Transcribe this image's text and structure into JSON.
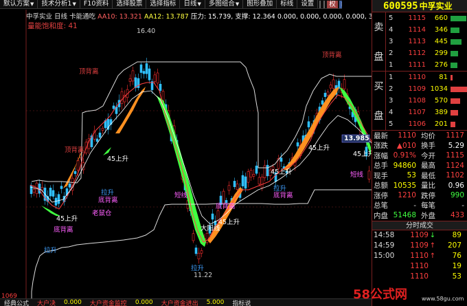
{
  "toolbar": {
    "buttons": [
      "默认方案",
      "技术分析1",
      "F10资料",
      "选择股票",
      "选择指标",
      "日线",
      "多图组合",
      "图形叠加",
      "标线",
      "设置"
    ],
    "tags": [
      "权",
      "线",
      "和"
    ]
  },
  "chart": {
    "info_line": {
      "stock": "中孚实业",
      "period": "日线",
      "extra": "卡能通吃",
      "aa10": "AA10: 13.321",
      "aa12": "AA12: 13.787",
      "pressure": "压力: 15.739,",
      "support": "支撑: 12.364",
      "zeros": "0.000, 0.000, 0.000, 0.000, 30.0"
    },
    "volume_degree": "量能饱和度: 41",
    "axis_left": [
      "1069"
    ],
    "annotations": [
      {
        "text": "16.40",
        "color": "#cccccc"
      },
      {
        "text": "顶背离",
        "color": "#e04040"
      },
      {
        "text": "顶背离",
        "color": "#e04040"
      },
      {
        "text": "顶背离",
        "color": "#e04040"
      },
      {
        "text": "45上升",
        "color": "#ffffff"
      },
      {
        "text": "45上升",
        "color": "#ffffff"
      },
      {
        "text": "45上升",
        "color": "#ffffff"
      },
      {
        "text": "45上升",
        "color": "#ffffff"
      },
      {
        "text": "45上升",
        "color": "#ffffff"
      },
      {
        "text": "45上升",
        "color": "#ffffff"
      },
      {
        "text": "拉升",
        "color": "#40a0ff"
      },
      {
        "text": "拉升",
        "color": "#40a0ff"
      },
      {
        "text": "拉升",
        "color": "#40a0ff"
      },
      {
        "text": "拉升",
        "color": "#40a0ff"
      },
      {
        "text": "底背离",
        "color": "#ff60ff"
      },
      {
        "text": "底背离",
        "color": "#ff60ff"
      },
      {
        "text": "底背离",
        "color": "#ff60ff"
      },
      {
        "text": "底背离",
        "color": "#ff60ff"
      },
      {
        "text": "老鼠仓",
        "color": "#ff60ff"
      },
      {
        "text": "大阳线",
        "color": "#ffffff"
      },
      {
        "text": "短线",
        "color": "#ff60ff"
      },
      {
        "text": "短线",
        "color": "#ff60ff"
      },
      {
        "text": "11.22",
        "color": "#cccccc"
      }
    ],
    "price_tag": "13.985"
  },
  "bottom_bar": [
    "经典公式",
    "大户决",
    "0.000",
    "大户资金监控",
    "0.000",
    "大户资金进出",
    "5.000",
    "指标说"
  ],
  "stock": {
    "code": "600595",
    "name": "中孚实业"
  },
  "sell_book": {
    "label": "卖盘",
    "rows": [
      {
        "idx": "5",
        "price": "1115",
        "vol": "660",
        "bar": 0.95
      },
      {
        "idx": "4",
        "price": "1114",
        "vol": "346",
        "bar": 0.55
      },
      {
        "idx": "3",
        "price": "1113",
        "vol": "445",
        "bar": 0.65
      },
      {
        "idx": "2",
        "price": "1112",
        "vol": "299",
        "bar": 0.45
      },
      {
        "idx": "1",
        "price": "1111",
        "vol": "276",
        "bar": 0.42
      }
    ]
  },
  "buy_book": {
    "label": "买盘",
    "rows": [
      {
        "idx": "1",
        "price": "1110",
        "vol": "81",
        "bar": 0.12
      },
      {
        "idx": "2",
        "price": "1109",
        "vol": "1034",
        "bar": 1.0
      },
      {
        "idx": "3",
        "price": "1108",
        "vol": "570",
        "bar": 0.6
      },
      {
        "idx": "4",
        "price": "1107",
        "vol": "389",
        "bar": 0.45
      },
      {
        "idx": "5",
        "price": "1106",
        "vol": "201",
        "bar": 0.28
      }
    ]
  },
  "quote": [
    {
      "l1": "最新",
      "v1": "1110",
      "c1": "#ff4040",
      "l2": "均价",
      "v2": "1117",
      "c2": "#ff4040"
    },
    {
      "l1": "涨跌",
      "v1": "▲010",
      "c1": "#ff4040",
      "l2": "换手",
      "v2": "5.29",
      "c2": "#ffffff"
    },
    {
      "l1": "涨幅",
      "v1": "0.91%",
      "c1": "#ff4040",
      "l2": "今开",
      "v2": "1115",
      "c2": "#ff4040"
    },
    {
      "l1": "总手",
      "v1": "94860",
      "c1": "#ffff00",
      "l2": "最高",
      "v2": "1124",
      "c2": "#ff4040"
    },
    {
      "l1": "现手",
      "v1": "53",
      "c1": "#ffff00",
      "l2": "最低",
      "v2": "1102",
      "c2": "#ff4040"
    },
    {
      "l1": "总额",
      "v1": "10535",
      "c1": "#ffff00",
      "l2": "量比",
      "v2": "0.96",
      "c2": "#ffffff"
    },
    {
      "l1": "涨停",
      "v1": "1210",
      "c1": "#ff4040",
      "l2": "跌停",
      "v2": "990",
      "c2": "#40ff40"
    },
    {
      "l1": "总笔",
      "v1": "-",
      "c1": "#dddddd",
      "l2": "每笔",
      "v2": "-",
      "c2": "#dddddd"
    },
    {
      "l1": "内盘",
      "v1": "51468",
      "c1": "#40ff40",
      "l2": "外盘",
      "v2": "433",
      "c2": "#ff4040"
    }
  ],
  "trades_title": "分时成交",
  "trades": [
    {
      "time": "14:58",
      "price": "1109",
      "arrow": "↓",
      "arrow_color": "#40ff40",
      "vol": "89"
    },
    {
      "time": "14:59",
      "price": "1109",
      "arrow": "↑",
      "arrow_color": "#ff4040",
      "vol": "207"
    },
    {
      "time": "15:00",
      "price": "1110",
      "arrow": "↑",
      "arrow_color": "#ff4040",
      "vol": "76"
    },
    {
      "time": "",
      "price": "1110",
      "arrow": "",
      "arrow_color": "#ff4040",
      "vol": "19"
    },
    {
      "time": "",
      "price": "1110",
      "arrow": "",
      "arrow_color": "#ff4040",
      "vol": "53"
    }
  ],
  "watermark": {
    "main": "58公式网",
    "url": "www.58gu.com"
  }
}
